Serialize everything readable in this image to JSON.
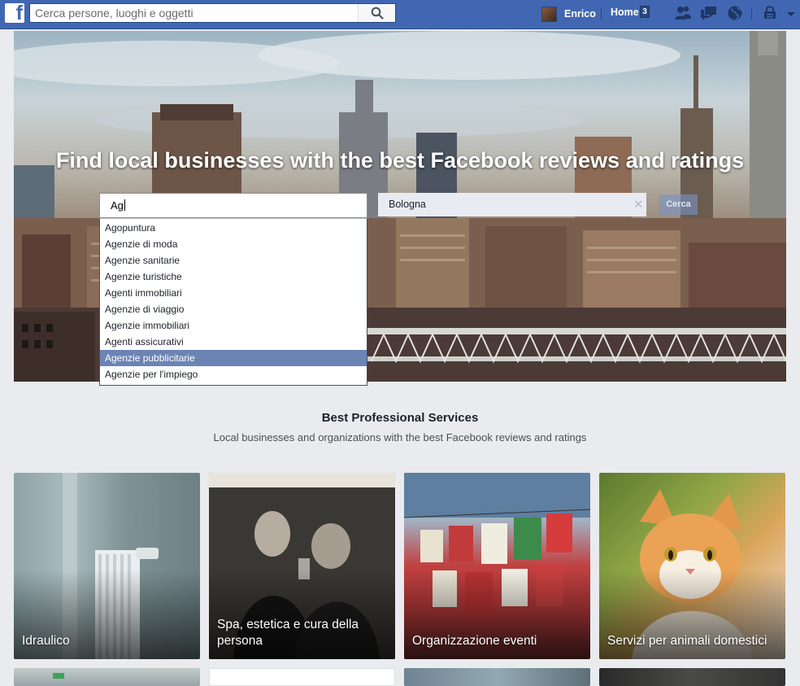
{
  "topbar": {
    "search_placeholder": "Cerca persone, luoghi e oggetti",
    "user_name": "Enrico",
    "home_label": "Home",
    "home_badge": "3",
    "brand_color": "#4267b2"
  },
  "hero": {
    "title": "Find local businesses with the best Facebook reviews and ratings",
    "what_value": "Ag",
    "where_value": "Bologna",
    "clear_symbol": "✕",
    "submit_label": "Cerca",
    "suggestions": [
      "Agopuntura",
      "Agenzie di moda",
      "Agenzie sanitarie",
      "Agenzie turistiche",
      "Agenti immobiliari",
      "Agenzie di viaggio",
      "Agenzie immobiliari",
      "Agenti assicurativi",
      "Agenzie pubblicitarie",
      "Agenzie per l'impiego"
    ],
    "highlighted_suggestion": "Agenzie pubblicitarie"
  },
  "section": {
    "title": "Best Professional Services",
    "subtitle": "Local businesses and organizations with the best Facebook reviews and ratings"
  },
  "cards": [
    {
      "label": "Idraulico"
    },
    {
      "label": "Spa, estetica e cura della persona"
    },
    {
      "label": "Organizzazione eventi"
    },
    {
      "label": "Servizi per animali domestici"
    }
  ]
}
